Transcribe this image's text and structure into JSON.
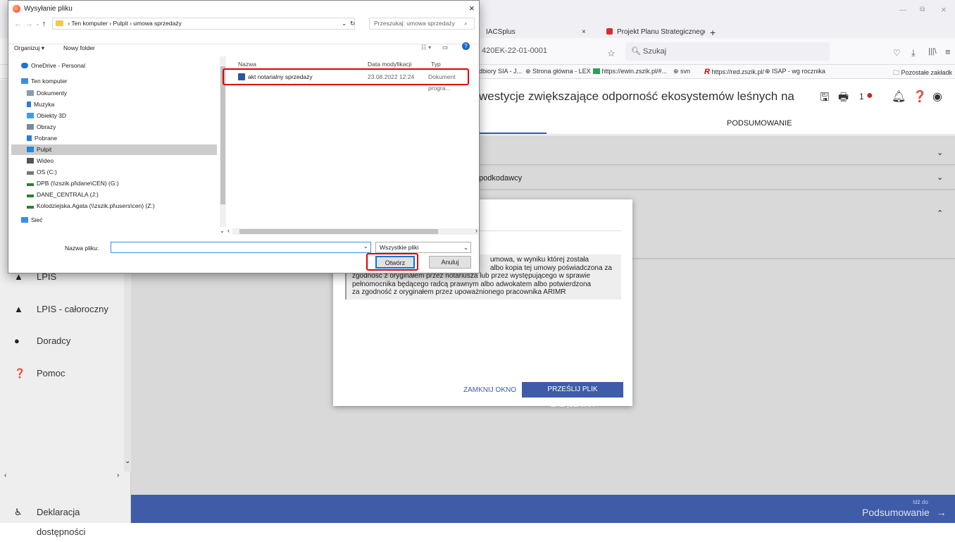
{
  "browser": {
    "tabs": [
      {
        "label": "IACSplus",
        "close": "×"
      },
      {
        "label": "Projekt Planu Strategicznego dla ×",
        "close": ""
      }
    ],
    "new_tab": "+",
    "window_controls": {
      "minimize": "—",
      "restore": "⧉",
      "close": "×"
    },
    "url": "420EK-22-01-0001",
    "search_placeholder": "Szukaj",
    "bookmarks": [
      "dbiory SIA - J...",
      "Strona główna - LEX",
      "https://ewin.zszik.pl/#...",
      "svn",
      "https://red.zszik.pl/",
      "ISAP - wg rocznika"
    ],
    "other_bookmarks": "Pozostałe zakładk"
  },
  "app": {
    "title": "westycje zwiększające odporność ekosystemów leśnych na",
    "notif_count": "1",
    "tab_summary": "PODSUMOWANIE",
    "accordion2_label": "podkodawcy",
    "sidebar": [
      {
        "label": "LPIS",
        "icon": "mountain-icon"
      },
      {
        "label": "LPIS - całoroczny",
        "icon": "mountain-icon"
      },
      {
        "label": "Doradcy",
        "icon": "person-icon"
      },
      {
        "label": "Pomoc",
        "icon": "help-icon"
      }
    ],
    "accessibility": "Deklaracja dostępności",
    "footer_goto": "Idź do",
    "footer_next": "Podsumowanie"
  },
  "modal": {
    "text_lines": [
      "umowa, w wyniku której została",
      "albo kopia tej umowy poświadczona za",
      "zgodność z oryginałem przez notariusza lub przez występującego w sprawie",
      "pełnomocnika będącego radcą prawnym albo adwokatem albo potwierdzona",
      "za zgodność z oryginałem przez upoważnionego pracownika ARIMR"
    ],
    "close_label": "ZAMKNIJ OKNO",
    "send_label": "PRZEŚLIJ PLIK ZAŁĄCZNIKA"
  },
  "dialog": {
    "title": "Wysyłanie pliku",
    "breadcrumb": [
      "Ten komputer",
      "Pulpit",
      "umowa sprzedaży"
    ],
    "search_placeholder": "Przeszukaj: umowa sprzedaży",
    "organize": "Organizuj ▾",
    "new_folder": "Nowy folder",
    "tree": [
      {
        "label": "OneDrive - Personal",
        "color": "#1e73d6"
      },
      {
        "label": "Ten komputer",
        "color": "#3a8ee6"
      },
      {
        "label": "Dokumenty",
        "color": "#8a9bb0"
      },
      {
        "label": "Muzyka",
        "color": "#2b7bd8"
      },
      {
        "label": "Obiekty 3D",
        "color": "#3aa0e0"
      },
      {
        "label": "Obrazy",
        "color": "#7a8a99"
      },
      {
        "label": "Pobrane",
        "color": "#2b7bd8"
      },
      {
        "label": "Pulpit",
        "color": "#1e88e5"
      },
      {
        "label": "Wideo",
        "color": "#555"
      },
      {
        "label": "OS (C:)",
        "color": "#777"
      },
      {
        "label": "DPB (\\\\zszik.pl\\dane\\CEN) (G:)",
        "color": "#2e7d32"
      },
      {
        "label": "DANE_CENTRALA (J:)",
        "color": "#2e7d32"
      },
      {
        "label": "Kolodziejska.Agata (\\\\zszik.pl\\users\\cen) (Z:)",
        "color": "#2e7d32"
      },
      {
        "label": "Sieć",
        "color": "#3a8ee6"
      }
    ],
    "columns": {
      "name": "Nazwa",
      "date": "Data modyfikacji",
      "type": "Typ"
    },
    "file": {
      "name": "akt notarialny sprzedaży",
      "date": "23.08.2022 12:24",
      "type": "Dokument progra..."
    },
    "filename_label": "Nazwa pliku:",
    "filter": "Wszystkie pliki",
    "open_label": "Otwórz",
    "cancel_label": "Anuluj"
  }
}
